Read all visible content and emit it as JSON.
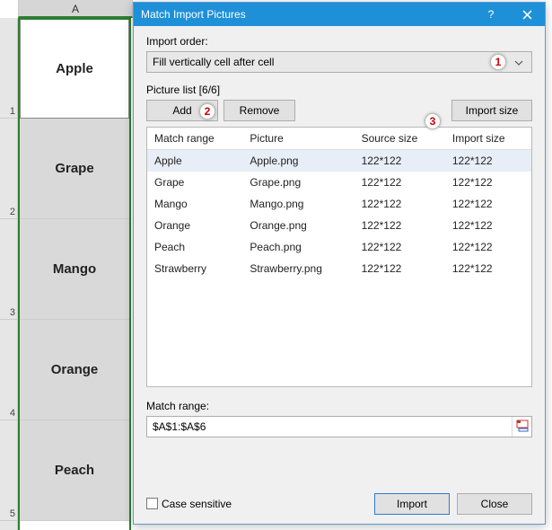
{
  "sheet": {
    "col_label": "A",
    "rows": [
      "Apple",
      "Grape",
      "Mango",
      "Orange",
      "Peach"
    ]
  },
  "dialog": {
    "title": "Match Import Pictures",
    "import_order_label": "Import order:",
    "import_order_value": "Fill vertically cell after cell",
    "picture_list_label": "Picture list [6/6]",
    "btn_add": "Add",
    "btn_remove": "Remove",
    "btn_import_size": "Import size",
    "columns": [
      "Match range",
      "Picture",
      "Source size",
      "Import size"
    ],
    "rows": [
      {
        "match": "Apple",
        "pic": "Apple.png",
        "src": "122*122",
        "imp": "122*122"
      },
      {
        "match": "Grape",
        "pic": "Grape.png",
        "src": "122*122",
        "imp": "122*122"
      },
      {
        "match": "Mango",
        "pic": "Mango.png",
        "src": "122*122",
        "imp": "122*122"
      },
      {
        "match": "Orange",
        "pic": "Orange.png",
        "src": "122*122",
        "imp": "122*122"
      },
      {
        "match": "Peach",
        "pic": "Peach.png",
        "src": "122*122",
        "imp": "122*122"
      },
      {
        "match": "Strawberry",
        "pic": "Strawberry.png",
        "src": "122*122",
        "imp": "122*122"
      }
    ],
    "match_range_label": "Match range:",
    "match_range_value": "$A$1:$A$6",
    "case_sensitive_label": "Case sensitive",
    "btn_import": "Import",
    "btn_close": "Close"
  },
  "annotations": {
    "a1": "1",
    "a2": "2",
    "a3": "3"
  }
}
